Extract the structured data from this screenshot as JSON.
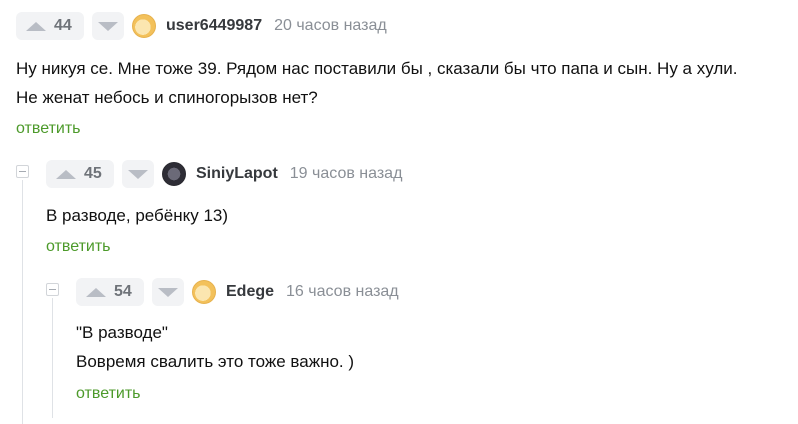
{
  "comments": [
    {
      "score": "44",
      "username": "user6449987",
      "time": "20 часов назад",
      "lines": [
        "Ну никуя се. Мне тоже 39. Рядом нас поставили бы , сказали бы что папа и сын. Ну а хули.",
        "Не женат небось и спиногорызов нет?"
      ],
      "reply_label": "ответить",
      "avatar_icon": "avatar-icon-orange"
    },
    {
      "score": "45",
      "username": "SiniyLapot",
      "time": "19 часов назад",
      "lines": [
        "В разводе, ребёнку 13)"
      ],
      "reply_label": "ответить",
      "avatar_icon": "avatar-icon-dark"
    },
    {
      "score": "54",
      "username": "Edege",
      "time": "16 часов назад",
      "lines": [
        "\"В разводе\"",
        "Вовремя свалить это тоже важно. )"
      ],
      "reply_label": "ответить",
      "avatar_icon": "avatar-icon-orange"
    }
  ],
  "colors": {
    "reply_link": "#4c9a2a",
    "vote_bg": "#f2f3f5",
    "muted_text": "#8a8f96",
    "thread_line": "#dfe2e6"
  }
}
